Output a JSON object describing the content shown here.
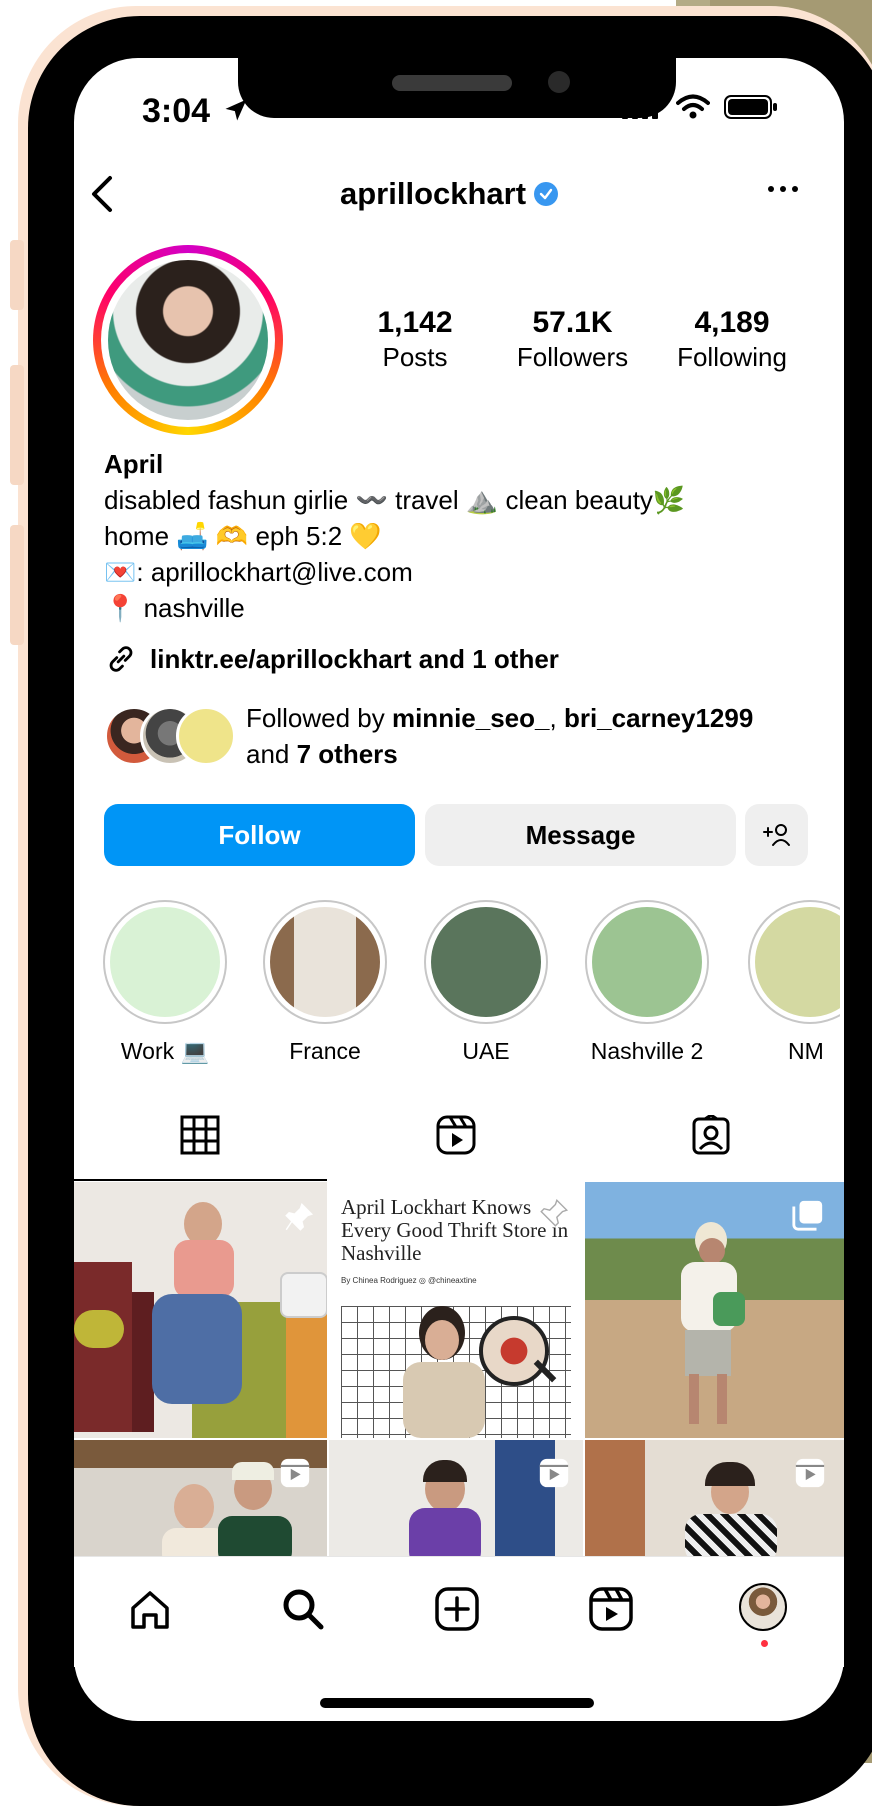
{
  "status_bar": {
    "time": "3:04"
  },
  "header": {
    "username": "aprillockhart"
  },
  "stats": [
    {
      "number": "1,142",
      "label": "Posts"
    },
    {
      "number": "57.1K",
      "label": "Followers"
    },
    {
      "number": "4,189",
      "label": "Following"
    }
  ],
  "bio": {
    "name": "April",
    "line1": "disabled fashun girlie 〰️ travel ⛰️ clean beauty🌿",
    "line2": "home 🛋️ 🫶 eph 5:2 💛",
    "line3": "💌: aprillockhart@live.com",
    "line4": "📍 nashville"
  },
  "link": {
    "text": "linktr.ee/aprillockhart and 1 other"
  },
  "followed_by": {
    "prefix": "Followed by ",
    "user1": "minnie_seo_",
    "sep": ", ",
    "user2": "bri_carney1299",
    "and": "and ",
    "others": "7 others"
  },
  "buttons": {
    "follow": "Follow",
    "message": "Message",
    "add_user": "+👤"
  },
  "highlights": [
    {
      "label": "Work 💻",
      "color": "#d9f2d5"
    },
    {
      "label": "France",
      "color": "#a88466"
    },
    {
      "label": "UAE",
      "color": "#5a755c"
    },
    {
      "label": "Nashville 2",
      "color": "#9cc492"
    },
    {
      "label": "NM",
      "color": "#d4d9a2"
    }
  ],
  "posts": {
    "article_title": "April Lockhart Knows Every Good Thrift Store in Nashville",
    "article_byline": "By Chinea Rodriguez  ◎ @chineaxtine"
  },
  "colors": {
    "follow_blue": "#0095f6",
    "verified_blue": "#3897f0",
    "notification_red": "#ff3040"
  }
}
